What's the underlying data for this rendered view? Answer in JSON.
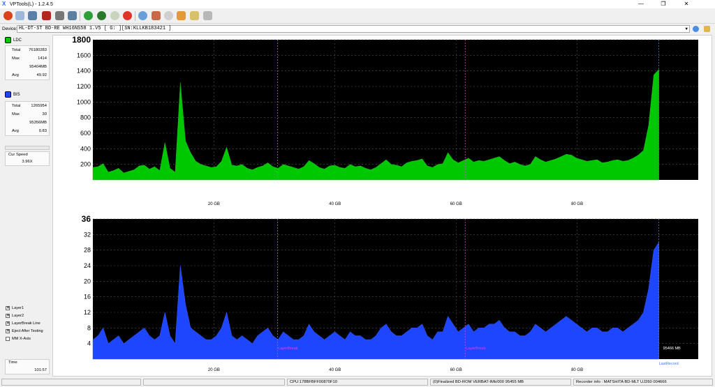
{
  "window": {
    "title": "VPTools(L) - 1.2.4.5",
    "minimize": "—",
    "restore": "❐",
    "close": "✕"
  },
  "device": {
    "label": "Device:",
    "value": "HL-DT-ST BD-RE  WH16NS58  1.V5 [ G: ][SN:KLLKB183421 ]"
  },
  "ldc": {
    "label": "LDC",
    "color": "#00c800",
    "total_label": "Total",
    "total": "76180283",
    "max_label": "Max",
    "max": "1414",
    "size": "95404MB",
    "avg_label": "Avg",
    "avg": "49.92"
  },
  "bis": {
    "label": "BIS",
    "color": "#1e46ff",
    "total_label": "Total",
    "total": "1265954",
    "max_label": "Max",
    "max": "30",
    "size": "95356MB",
    "avg_label": "Avg",
    "avg": "0.83"
  },
  "speed": {
    "label": "Cur Speed",
    "value": "3.96X"
  },
  "options": [
    {
      "label": "Layer1",
      "checked": true
    },
    {
      "label": "Layer2",
      "checked": true
    },
    {
      "label": "LayerBreak Line",
      "checked": true
    },
    {
      "label": "Eject After Testing",
      "checked": true
    },
    {
      "label": "MM X-Axis",
      "checked": false
    }
  ],
  "time": {
    "label": "Time",
    "value": "101:57"
  },
  "chart_data": [
    {
      "type": "area",
      "series": [
        {
          "values": [
            160,
            170,
            210,
            100,
            120,
            150,
            90,
            110,
            130,
            180,
            190,
            140,
            170,
            120,
            480,
            150,
            100,
            1250,
            500,
            350,
            240,
            200,
            180,
            160,
            170,
            240,
            420,
            190,
            180,
            200,
            150,
            130,
            160,
            180,
            220,
            170,
            150,
            200,
            180,
            160,
            140,
            170,
            250,
            210,
            160,
            140,
            180,
            190,
            160,
            150,
            200,
            170,
            180,
            150,
            130,
            160,
            210,
            260,
            200,
            190,
            170,
            220,
            240,
            250,
            270,
            180,
            160,
            200,
            210,
            350,
            260,
            220,
            250,
            280,
            230,
            250,
            240,
            260,
            280,
            300,
            250,
            210,
            230,
            200,
            180,
            200,
            300,
            260,
            230,
            250,
            270,
            300,
            330,
            320,
            280,
            260,
            240,
            250,
            260,
            220,
            230,
            250,
            260,
            240,
            250,
            280,
            320,
            380,
            700,
            1350,
            1420
          ]
        }
      ],
      "yticks": [
        200,
        400,
        600,
        800,
        1000,
        1200,
        1400,
        1600,
        1800
      ],
      "ylim": [
        0,
        1800
      ],
      "xticks": [
        20,
        40,
        60,
        80
      ],
      "xlabels": [
        "20 GB",
        "40 GB",
        "60 GB",
        "80 GB"
      ],
      "xlim": [
        0,
        100
      ],
      "layerbreaks": [
        30.5,
        61.5
      ],
      "lastrecord": 93.5
    },
    {
      "type": "area",
      "series": [
        {
          "values": [
            5,
            6,
            8,
            4,
            5,
            6,
            4,
            5,
            6,
            7,
            8,
            6,
            5,
            6,
            12,
            6,
            4,
            24,
            14,
            8,
            7,
            6,
            5,
            5,
            6,
            8,
            12,
            6,
            5,
            6,
            5,
            4,
            6,
            7,
            8,
            6,
            5,
            7,
            6,
            5,
            5,
            6,
            9,
            7,
            6,
            5,
            6,
            7,
            6,
            5,
            7,
            6,
            6,
            5,
            5,
            6,
            8,
            9,
            7,
            6,
            6,
            7,
            8,
            8,
            9,
            6,
            5,
            7,
            7,
            11,
            9,
            7,
            8,
            9,
            7,
            8,
            8,
            9,
            9,
            10,
            8,
            7,
            7,
            6,
            6,
            7,
            9,
            8,
            7,
            8,
            9,
            10,
            11,
            10,
            9,
            8,
            7,
            8,
            8,
            7,
            7,
            8,
            8,
            7,
            8,
            9,
            10,
            12,
            18,
            28,
            30
          ]
        }
      ],
      "yticks": [
        4,
        8,
        12,
        16,
        20,
        24,
        28,
        32,
        36
      ],
      "ylim": [
        0,
        36
      ],
      "xticks": [
        20,
        40,
        60,
        80
      ],
      "xlabels": [
        "20 GB",
        "40 GB",
        "60 GB",
        "80 GB"
      ],
      "xlim": [
        0,
        100
      ],
      "layerbreaks": [
        30.5,
        61.5
      ],
      "lastrecord": 93.5,
      "annotations": {
        "layerbreak": "LayerBreak",
        "lastrecord": "LastRecord",
        "size": "95466 MB"
      }
    }
  ],
  "status": {
    "cpu": "CPU:178BFBFF00870F10",
    "disc": "(0)Finalized  BD-ROM  VERBAT-IMk/000  95455 MB",
    "recorder": "Recorder info : MATSHITA     BD-MLT UJ260     004666"
  }
}
